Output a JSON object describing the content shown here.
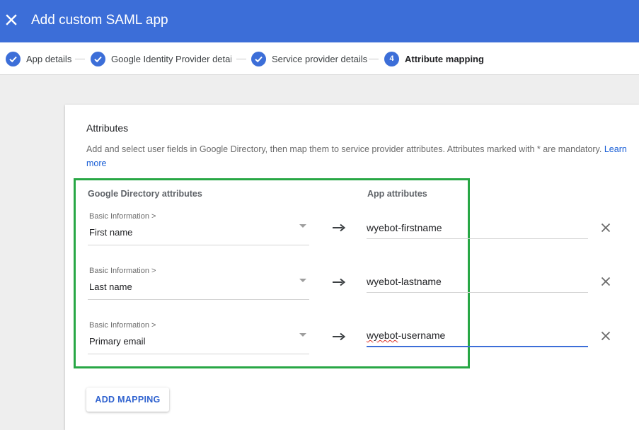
{
  "header": {
    "title": "Add custom SAML app",
    "close_icon": "close-icon",
    "color": "#3c6ed8"
  },
  "stepper": {
    "steps": [
      {
        "label": "App details",
        "state": "complete",
        "icon": "check-icon"
      },
      {
        "label": "Google Identity Provider details",
        "state": "complete",
        "icon": "check-icon"
      },
      {
        "label": "Service provider details",
        "state": "complete",
        "icon": "check-icon"
      },
      {
        "label": "Attribute mapping",
        "state": "active",
        "number": "4"
      }
    ]
  },
  "attributes": {
    "title": "Attributes",
    "description": "Add and select user fields in Google Directory, then map them to service provider attributes. Attributes marked with * are mandatory.",
    "learn_more_link": "Learn more",
    "google_col_header": "Google Directory attributes",
    "app_col_header": "App attributes",
    "mappings": [
      {
        "category": "Basic Information >",
        "field": "First name",
        "app_attribute": "wyebot-firstname"
      },
      {
        "category": "Basic Information >",
        "field": "Last name",
        "app_attribute": "wyebot-lastname"
      },
      {
        "category": "Basic Information >",
        "field": "Primary email",
        "app_attribute_prefix": "wyebot",
        "app_attribute_suffix": "-username"
      }
    ],
    "add_mapping_label": "ADD MAPPING",
    "highlight_color": "#28a745"
  }
}
